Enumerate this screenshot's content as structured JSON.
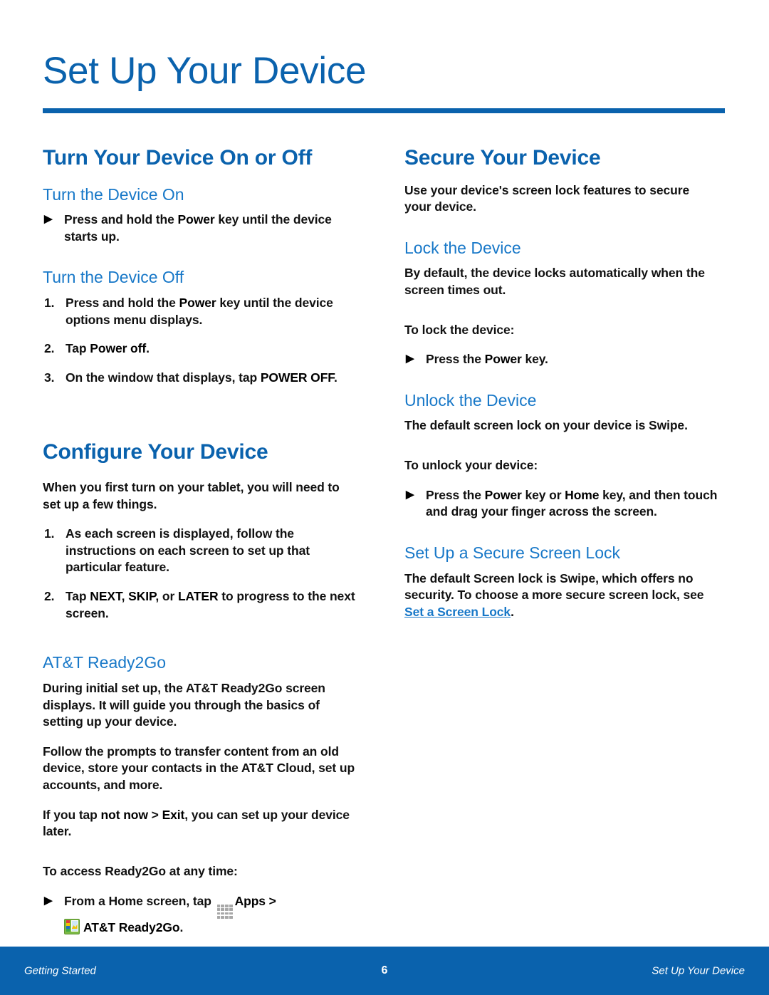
{
  "page": {
    "title": "Set Up Your Device",
    "accent_dark": "#0a62ad",
    "accent_light": "#1878c8"
  },
  "left_column": {
    "section1": {
      "heading": "Turn Your Device On or Off",
      "sub1": {
        "heading": "Turn the Device On",
        "bullet_pre": "Press and hold the ",
        "bullet_bold": "Power",
        "bullet_post": " key until the device starts up."
      },
      "sub2": {
        "heading": "Turn the Device Off",
        "steps": [
          {
            "num": "1.",
            "pre": "Press and hold the ",
            "bold": "Power",
            "post": " key until the device options menu displays."
          },
          {
            "num": "2.",
            "pre": "Tap ",
            "bold": "Power off",
            "post": "."
          },
          {
            "num": "3.",
            "pre": "On the window that displays, tap ",
            "bold": "POWER OFF",
            "post": "."
          }
        ]
      }
    },
    "section2": {
      "heading": "Configure Your Device",
      "intro": "When you first turn on your tablet, you will need to set up a few things.",
      "steps": [
        {
          "num": "1.",
          "text": "As each screen is displayed, follow the instructions on each screen to set up that particular feature."
        },
        {
          "num": "2.",
          "pre": "Tap ",
          "bold1": "NEXT",
          "mid1": ", ",
          "bold2": "SKIP",
          "mid2": ", or ",
          "bold3": "LATER",
          "post": " to progress to the next screen."
        }
      ],
      "sub1": {
        "heading": "AT&T Ready2Go",
        "para1": "During initial set up, the AT&T Ready2Go screen displays. It will guide you through the basics of setting up your device.",
        "para2": "Follow the prompts to transfer content from an old device, store your contacts in the AT&T Cloud, set up accounts, and more.",
        "para3_pre": "If you tap ",
        "para3_bold1": "not now",
        "para3_mid": " > ",
        "para3_bold2": "Exit",
        "para3_post": ", you can set up your device later.",
        "access_intro": "To access Ready2Go at any time:",
        "access_bullet_pre": "From a Home screen, tap ",
        "access_bullet_apps": "Apps",
        "access_bullet_arrow": " > ",
        "access_bullet_app": "AT&T Ready2Go",
        "access_bullet_post": "."
      }
    }
  },
  "right_column": {
    "section1": {
      "heading": "Secure Your Device",
      "intro": "Use your device's screen lock features to secure your device.",
      "sub1": {
        "heading": "Lock the Device",
        "para1": "By default, the device locks automatically when the screen times out.",
        "para2": "To lock the device:",
        "bullet_pre": "Press the ",
        "bullet_bold": "Power",
        "bullet_post": " key."
      },
      "sub2": {
        "heading": "Unlock the Device",
        "para1": "The default screen lock on your device is Swipe.",
        "para2": "To unlock your device:",
        "bullet_pre": "Press the ",
        "bullet_bold1": "Power",
        "bullet_mid": " key or ",
        "bullet_bold2": "Home",
        "bullet_post": " key, and then touch and drag your finger across the screen."
      },
      "sub3": {
        "heading": "Set Up a Secure Screen Lock",
        "para_pre": "The default Screen lock is Swipe, which offers no security. To choose a more secure screen lock, see ",
        "link": "Set a Screen Lock",
        "para_post": "."
      }
    }
  },
  "footer": {
    "left": "Getting Started",
    "page_number": "6",
    "right": "Set Up Your Device"
  },
  "icons": {
    "apps": "apps-grid-icon",
    "ready2go": "att-ready2go-app-icon",
    "bullet": "triangle-bullet-icon"
  }
}
